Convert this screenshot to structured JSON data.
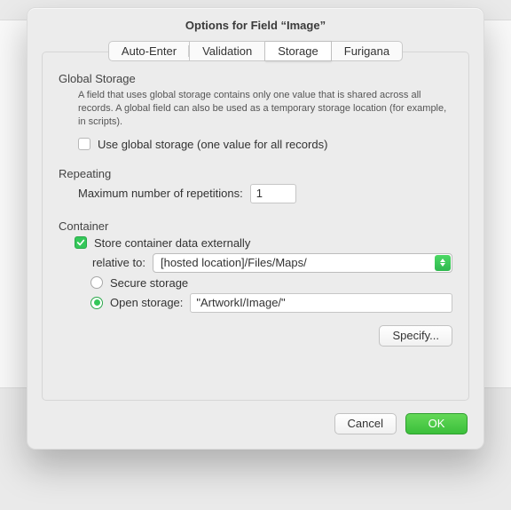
{
  "dialog": {
    "title": "Options for Field “Image”"
  },
  "tabs": {
    "auto_enter": "Auto-Enter",
    "validation": "Validation",
    "storage": "Storage",
    "furigana": "Furigana"
  },
  "global_storage": {
    "heading": "Global Storage",
    "help": "A field that uses global storage contains only one value that is shared across all records.  A global field can also be used as a temporary storage location (for example, in scripts).",
    "checkbox_label": "Use global storage (one value for all records)",
    "checked": false
  },
  "repeating": {
    "heading": "Repeating",
    "label": "Maximum number of repetitions:",
    "value": "1"
  },
  "container": {
    "heading": "Container",
    "external_label": "Store container data externally",
    "external_checked": true,
    "relative_label": "relative to:",
    "relative_value": "[hosted location]/Files/Maps/",
    "secure_label": "Secure storage",
    "open_label": "Open storage:",
    "open_value": "\"ArtworkI/Image/\"",
    "storage_mode": "open",
    "specify_label": "Specify..."
  },
  "footer": {
    "cancel": "Cancel",
    "ok": "OK"
  }
}
